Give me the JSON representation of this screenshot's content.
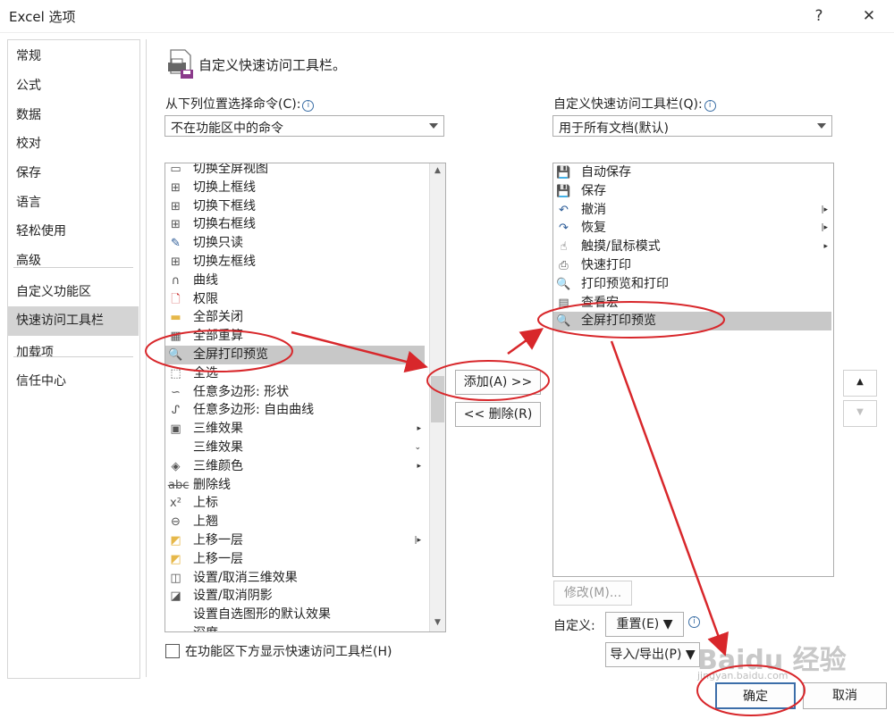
{
  "window": {
    "title": "Excel 选项",
    "help_label": "?",
    "close_label": "✕"
  },
  "sidebar": {
    "items": [
      {
        "label": "常规"
      },
      {
        "label": "公式"
      },
      {
        "label": "数据"
      },
      {
        "label": "校对"
      },
      {
        "label": "保存"
      },
      {
        "label": "语言"
      },
      {
        "label": "轻松使用"
      },
      {
        "label": "高级"
      },
      {
        "label": "自定义功能区"
      },
      {
        "label": "快速访问工具栏"
      },
      {
        "label": "加载项"
      },
      {
        "label": "信任中心"
      }
    ],
    "active_index": 9
  },
  "main": {
    "heading": "自定义快速访问工具栏。",
    "choose_label": "从下列位置选择命令(C):",
    "choose_value": "不在功能区中的命令",
    "customize_label": "自定义快速访问工具栏(Q):",
    "customize_value": "用于所有文档(默认)",
    "commands": [
      {
        "label": "切换全屏视图",
        "icon": "fullscreen-icon"
      },
      {
        "label": "切换上框线",
        "icon": "border-top-icon"
      },
      {
        "label": "切换下框线",
        "icon": "border-bottom-icon"
      },
      {
        "label": "切换右框线",
        "icon": "border-right-icon"
      },
      {
        "label": "切换只读",
        "icon": "readonly-icon"
      },
      {
        "label": "切换左框线",
        "icon": "border-left-icon"
      },
      {
        "label": "曲线",
        "icon": "curve-icon"
      },
      {
        "label": "权限",
        "icon": "permission-icon"
      },
      {
        "label": "全部关闭",
        "icon": "folder-icon"
      },
      {
        "label": "全部重算",
        "icon": "calculator-icon"
      },
      {
        "label": "全屏打印预览",
        "icon": "print-preview-icon",
        "selected": true
      },
      {
        "label": "全选",
        "icon": "select-all-icon"
      },
      {
        "label": "任意多边形: 形状",
        "icon": "freeform-shape-icon"
      },
      {
        "label": "任意多边形: 自由曲线",
        "icon": "scribble-icon"
      },
      {
        "label": "三维效果",
        "icon": "3d-effect-icon",
        "submenu": "▸"
      },
      {
        "label": "三维效果",
        "icon": "",
        "submenu": "⌄"
      },
      {
        "label": "三维颜色",
        "icon": "3d-color-icon",
        "submenu": "▸"
      },
      {
        "label": "删除线",
        "icon": "strikethrough-icon"
      },
      {
        "label": "上标",
        "icon": "superscript-icon"
      },
      {
        "label": "上翘",
        "icon": "tilt-up-icon"
      },
      {
        "label": "上移一层",
        "icon": "bring-forward-icon",
        "submenu": "|▸"
      },
      {
        "label": "上移一层",
        "icon": "bring-forward-icon"
      },
      {
        "label": "设置/取消三维效果",
        "icon": "3d-toggle-icon"
      },
      {
        "label": "设置/取消阴影",
        "icon": "shadow-icon"
      },
      {
        "label": "设置自选图形的默认效果",
        "icon": ""
      },
      {
        "label": "深度",
        "icon": "depth-icon"
      }
    ],
    "toolbar_items": [
      {
        "label": "自动保存",
        "icon": "save-icon"
      },
      {
        "label": "保存",
        "icon": "save-icon"
      },
      {
        "label": "撤消",
        "icon": "undo-icon",
        "submenu": "|▸"
      },
      {
        "label": "恢复",
        "icon": "redo-icon",
        "submenu": "|▸"
      },
      {
        "label": "触摸/鼠标模式",
        "icon": "touch-mode-icon",
        "submenu": "▸"
      },
      {
        "label": "快速打印",
        "icon": "quick-print-icon"
      },
      {
        "label": "打印预览和打印",
        "icon": "print-preview-icon"
      },
      {
        "label": "查看宏",
        "icon": "macro-icon"
      },
      {
        "label": "全屏打印预览",
        "icon": "print-preview-icon",
        "selected": true
      }
    ],
    "add_button": "添加(A) >>",
    "remove_button": "<< 删除(R)",
    "modify_button": "修改(M)...",
    "customize_label2": "自定义:",
    "reset_button": "重置(E) ▼",
    "import_export_button": "导入/导出(P) ▼",
    "show_below_label": "在功能区下方显示快速访问工具栏(H)",
    "up_arrow": "▲",
    "down_arrow": "▼"
  },
  "footer": {
    "ok_label": "确定",
    "cancel_label": "取消"
  },
  "watermark": {
    "text": "Baidu 经验",
    "url": "jingyan.baidu.com"
  },
  "colors": {
    "annotation": "#d8272b",
    "selected_row": "#c8c8c8",
    "active_sidebar": "#d4d4d4"
  }
}
